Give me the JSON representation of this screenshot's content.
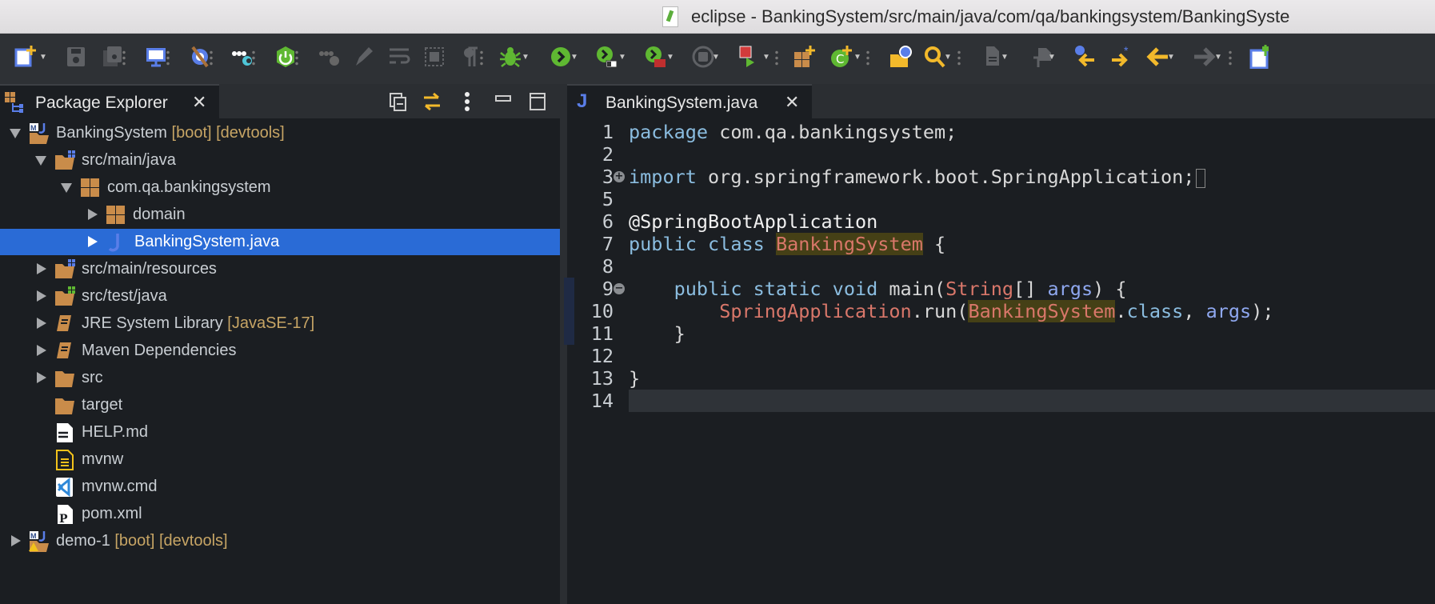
{
  "window": {
    "title": "eclipse - BankingSystem/src/main/java/com/qa/bankingsystem/BankingSyste",
    "traffic_lights": [
      "#ee6a5f",
      "#f5be4f",
      "#61c454"
    ]
  },
  "toolbar": {
    "items": [
      "new",
      "save",
      "save-all",
      "|",
      "monitor",
      "|",
      "skip-breakpoints",
      "|",
      "toggle-dots",
      "|",
      "spring-boot",
      "|",
      "toggle-dots-disabled",
      "mark-occurrences",
      "word-wrap",
      "block-selection",
      "show-whitespace",
      "|",
      "debug",
      "run",
      "run-external",
      "external-tools",
      "stop",
      "|",
      "coverage",
      "|",
      "new-package",
      "new-class",
      "|",
      "open-type",
      "search",
      "|",
      "last-edit",
      "next-annotation",
      "previous-annotation",
      "next-edit",
      "back",
      "forward",
      "|",
      "pin-editor"
    ]
  },
  "package_explorer": {
    "tab_label": "Package Explorer",
    "tree": [
      {
        "level": 0,
        "state": "open",
        "icon": "maven-project",
        "label": "BankingSystem",
        "deco": " [boot] [devtools]"
      },
      {
        "level": 1,
        "state": "open",
        "icon": "source-folder",
        "label": "src/main/java"
      },
      {
        "level": 2,
        "state": "open",
        "icon": "package",
        "label": "com.qa.bankingsystem"
      },
      {
        "level": 3,
        "state": "closed",
        "icon": "package",
        "label": "domain"
      },
      {
        "level": 3,
        "state": "closed",
        "icon": "java-file",
        "label": "BankingSystem.java",
        "selected": true
      },
      {
        "level": 1,
        "state": "closed",
        "icon": "source-folder",
        "label": "src/main/resources"
      },
      {
        "level": 1,
        "state": "closed",
        "icon": "test-folder",
        "label": "src/test/java"
      },
      {
        "level": 1,
        "state": "closed",
        "icon": "library",
        "label": "JRE System Library",
        "deco": " [JavaSE-17]"
      },
      {
        "level": 1,
        "state": "closed",
        "icon": "library",
        "label": "Maven Dependencies"
      },
      {
        "level": 1,
        "state": "closed",
        "icon": "folder",
        "label": "src"
      },
      {
        "level": 1,
        "state": "none",
        "icon": "folder",
        "label": "target"
      },
      {
        "level": 1,
        "state": "none",
        "icon": "markdown-file",
        "label": "HELP.md"
      },
      {
        "level": 1,
        "state": "none",
        "icon": "text-file",
        "label": "mvnw"
      },
      {
        "level": 1,
        "state": "none",
        "icon": "vscode-file",
        "label": "mvnw.cmd"
      },
      {
        "level": 1,
        "state": "none",
        "icon": "pom-file",
        "label": "pom.xml"
      },
      {
        "level": 0,
        "state": "closed",
        "icon": "maven-project-warning",
        "label": "demo-1",
        "deco": " [boot] [devtools]"
      }
    ]
  },
  "editor": {
    "tab_label": "BankingSystem.java",
    "current_line": "14",
    "lines": [
      {
        "n": "1",
        "t": [
          [
            "package",
            "kw"
          ],
          [
            " com.qa.bankingsystem;",
            ""
          ]
        ]
      },
      {
        "n": "2",
        "t": []
      },
      {
        "n": "3",
        "fold": "+",
        "t": [
          [
            "import",
            "kw"
          ],
          [
            " org.springframework.boot.SpringApplication;",
            ""
          ]
        ],
        "folded": true
      },
      {
        "n": "5",
        "t": []
      },
      {
        "n": "6",
        "t": [
          [
            "@SpringBootApplication",
            "ann"
          ]
        ]
      },
      {
        "n": "7",
        "t": [
          [
            "public class",
            "kw"
          ],
          [
            " ",
            ""
          ],
          [
            "BankingSystem",
            "cls hl"
          ],
          [
            " {",
            ""
          ]
        ]
      },
      {
        "n": "8",
        "t": []
      },
      {
        "n": "9",
        "fold": "-",
        "t": [
          [
            "    ",
            ""
          ],
          [
            "public static void",
            "kw"
          ],
          [
            " main(",
            ""
          ],
          [
            "String",
            "cls"
          ],
          [
            "[] ",
            ""
          ],
          [
            "args",
            "var"
          ],
          [
            ") {",
            ""
          ]
        ]
      },
      {
        "n": "10",
        "t": [
          [
            "        ",
            ""
          ],
          [
            "SpringApplication",
            "cls"
          ],
          [
            ".run(",
            ""
          ],
          [
            "BankingSystem",
            "cls hl"
          ],
          [
            ".",
            ""
          ],
          [
            "class",
            "kw"
          ],
          [
            ", ",
            ""
          ],
          [
            "args",
            "var"
          ],
          [
            ");",
            ""
          ]
        ]
      },
      {
        "n": "11",
        "t": [
          [
            "    }",
            ""
          ]
        ]
      },
      {
        "n": "12",
        "t": []
      },
      {
        "n": "13",
        "t": [
          [
            "}",
            ""
          ]
        ]
      },
      {
        "n": "14",
        "t": []
      }
    ]
  }
}
